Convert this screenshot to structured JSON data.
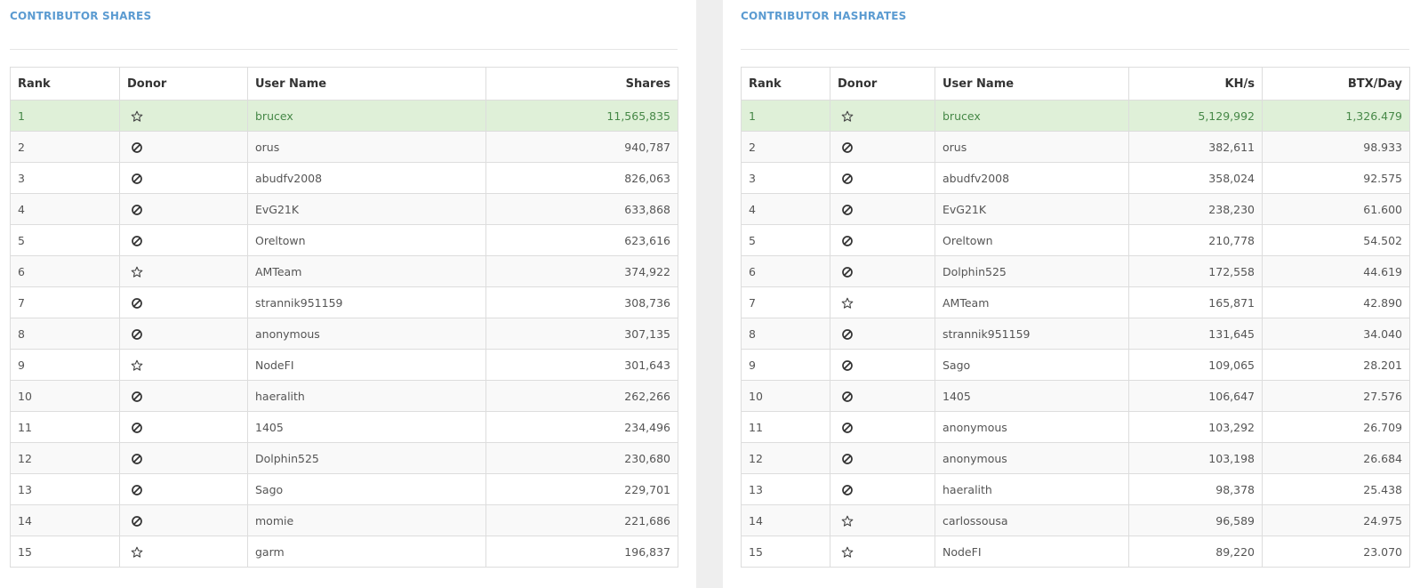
{
  "shares_panel": {
    "title": "CONTRIBUTOR SHARES",
    "columns": [
      "Rank",
      "Donor",
      "User Name",
      "Shares"
    ],
    "rows": [
      {
        "rank": "1",
        "donor": "star-icon",
        "user": "brucex",
        "shares": "11,565,835"
      },
      {
        "rank": "2",
        "donor": "no-donor-icon",
        "user": "orus",
        "shares": "940,787"
      },
      {
        "rank": "3",
        "donor": "no-donor-icon",
        "user": "abudfv2008",
        "shares": "826,063"
      },
      {
        "rank": "4",
        "donor": "no-donor-icon",
        "user": "EvG21K",
        "shares": "633,868"
      },
      {
        "rank": "5",
        "donor": "no-donor-icon",
        "user": "Oreltown",
        "shares": "623,616"
      },
      {
        "rank": "6",
        "donor": "star-icon",
        "user": "AMTeam",
        "shares": "374,922"
      },
      {
        "rank": "7",
        "donor": "no-donor-icon",
        "user": "strannik951159",
        "shares": "308,736"
      },
      {
        "rank": "8",
        "donor": "no-donor-icon",
        "user": "anonymous",
        "shares": "307,135"
      },
      {
        "rank": "9",
        "donor": "star-icon",
        "user": "NodeFI",
        "shares": "301,643"
      },
      {
        "rank": "10",
        "donor": "no-donor-icon",
        "user": "haeralith",
        "shares": "262,266"
      },
      {
        "rank": "11",
        "donor": "no-donor-icon",
        "user": "1405",
        "shares": "234,496"
      },
      {
        "rank": "12",
        "donor": "no-donor-icon",
        "user": "Dolphin525",
        "shares": "230,680"
      },
      {
        "rank": "13",
        "donor": "no-donor-icon",
        "user": "Sago",
        "shares": "229,701"
      },
      {
        "rank": "14",
        "donor": "no-donor-icon",
        "user": "momie",
        "shares": "221,686"
      },
      {
        "rank": "15",
        "donor": "star-icon",
        "user": "garm",
        "shares": "196,837"
      }
    ]
  },
  "hashrate_panel": {
    "title": "CONTRIBUTOR HASHRATES",
    "columns": [
      "Rank",
      "Donor",
      "User Name",
      "KH/s",
      "BTX/Day"
    ],
    "rows": [
      {
        "rank": "1",
        "donor": "star-icon",
        "user": "brucex",
        "khs": "5,129,992",
        "btx": "1,326.479"
      },
      {
        "rank": "2",
        "donor": "no-donor-icon",
        "user": "orus",
        "khs": "382,611",
        "btx": "98.933"
      },
      {
        "rank": "3",
        "donor": "no-donor-icon",
        "user": "abudfv2008",
        "khs": "358,024",
        "btx": "92.575"
      },
      {
        "rank": "4",
        "donor": "no-donor-icon",
        "user": "EvG21K",
        "khs": "238,230",
        "btx": "61.600"
      },
      {
        "rank": "5",
        "donor": "no-donor-icon",
        "user": "Oreltown",
        "khs": "210,778",
        "btx": "54.502"
      },
      {
        "rank": "6",
        "donor": "no-donor-icon",
        "user": "Dolphin525",
        "khs": "172,558",
        "btx": "44.619"
      },
      {
        "rank": "7",
        "donor": "star-icon",
        "user": "AMTeam",
        "khs": "165,871",
        "btx": "42.890"
      },
      {
        "rank": "8",
        "donor": "no-donor-icon",
        "user": "strannik951159",
        "khs": "131,645",
        "btx": "34.040"
      },
      {
        "rank": "9",
        "donor": "no-donor-icon",
        "user": "Sago",
        "khs": "109,065",
        "btx": "28.201"
      },
      {
        "rank": "10",
        "donor": "no-donor-icon",
        "user": "1405",
        "khs": "106,647",
        "btx": "27.576"
      },
      {
        "rank": "11",
        "donor": "no-donor-icon",
        "user": "anonymous",
        "khs": "103,292",
        "btx": "26.709"
      },
      {
        "rank": "12",
        "donor": "no-donor-icon",
        "user": "anonymous",
        "khs": "103,198",
        "btx": "26.684"
      },
      {
        "rank": "13",
        "donor": "no-donor-icon",
        "user": "haeralith",
        "khs": "98,378",
        "btx": "25.438"
      },
      {
        "rank": "14",
        "donor": "star-icon",
        "user": "carlossousa",
        "khs": "96,589",
        "btx": "24.975"
      },
      {
        "rank": "15",
        "donor": "star-icon",
        "user": "NodeFI",
        "khs": "89,220",
        "btx": "23.070"
      }
    ]
  },
  "colors": {
    "title_blue": "#5b9bd1",
    "highlight_row": "#dff0d8",
    "highlight_text": "#468847",
    "gutter": "#eeeeee"
  }
}
